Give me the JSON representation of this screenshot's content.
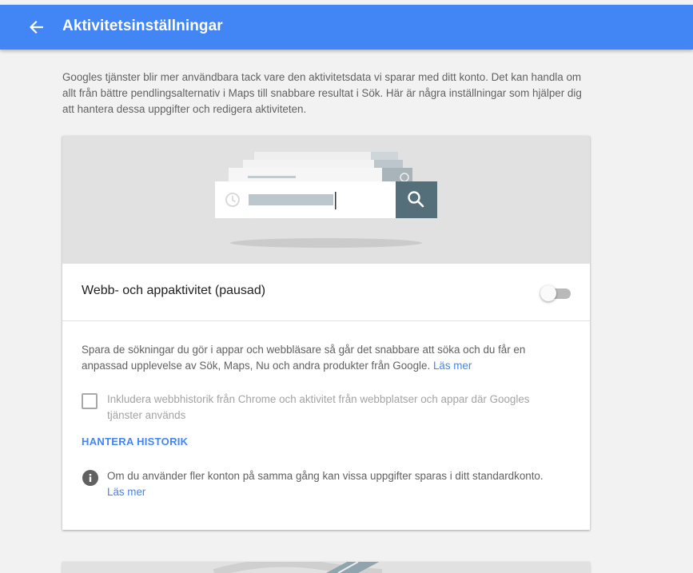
{
  "appbar": {
    "title": "Aktivitetsinställningar",
    "back_icon": "arrow-back-icon",
    "color": "#4285f4"
  },
  "intro": {
    "text": "Googles tjänster blir mer användbara tack vare den aktivitetsdata vi sparar med ditt konto. Det kan handla om allt från bättre pendlingsalternativ i Maps till snabbare resultat i Sök. Här är några inställningar som hjälper dig att hantera dessa uppgifter och redigera aktiviteten."
  },
  "card": {
    "hero_icons": [
      "history-icon",
      "search-icon"
    ],
    "title": "Webb- och appaktivitet (pausad)",
    "toggle_on": false,
    "description": "Spara de sökningar du gör i appar och webbläsare så går det snabbare att söka och du får en anpassad upplevelse av Sök, Maps, Nu och andra produkter från Google.",
    "description_link": "Läs mer",
    "checkbox_label": "Inkludera webbhistorik från Chrome och aktivitet från webbplatser och appar där Googles tjänster används",
    "checkbox_checked": false,
    "manage_label": "HANTERA HISTORIK",
    "info_icon": "info-icon",
    "info_text": "Om du använder fler konton på samma gång kan vissa uppgifter sparas i ditt standardkonto.",
    "info_link": "Läs mer",
    "accent_color": "#4285f4"
  }
}
